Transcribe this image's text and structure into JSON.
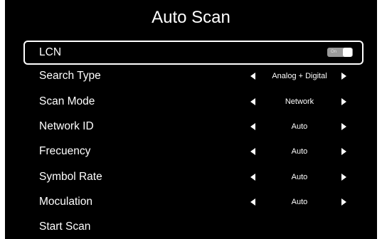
{
  "title": "Auto Scan",
  "toggle_state": "On",
  "colors": {
    "background": "#000000",
    "text": "#ffffff",
    "toggle_track": "#9a9a9a",
    "focus_border": "#ffffff"
  },
  "rows": [
    {
      "label": "LCN",
      "kind": "toggle",
      "value": true,
      "focused": true
    },
    {
      "label": "Search Type",
      "kind": "select",
      "value": "Analog + Digital"
    },
    {
      "label": "Scan Mode",
      "kind": "select",
      "value": "Network"
    },
    {
      "label": "Network ID",
      "kind": "select",
      "value": "Auto"
    },
    {
      "label": "Frecuency",
      "kind": "select",
      "value": "Auto"
    },
    {
      "label": "Symbol Rate",
      "kind": "select",
      "value": "Auto"
    },
    {
      "label": "Moculation",
      "kind": "select",
      "value": "Auto"
    },
    {
      "label": "Start Scan",
      "kind": "action"
    }
  ],
  "icons": {
    "prev": "triangle-left-icon",
    "next": "triangle-right-icon"
  }
}
